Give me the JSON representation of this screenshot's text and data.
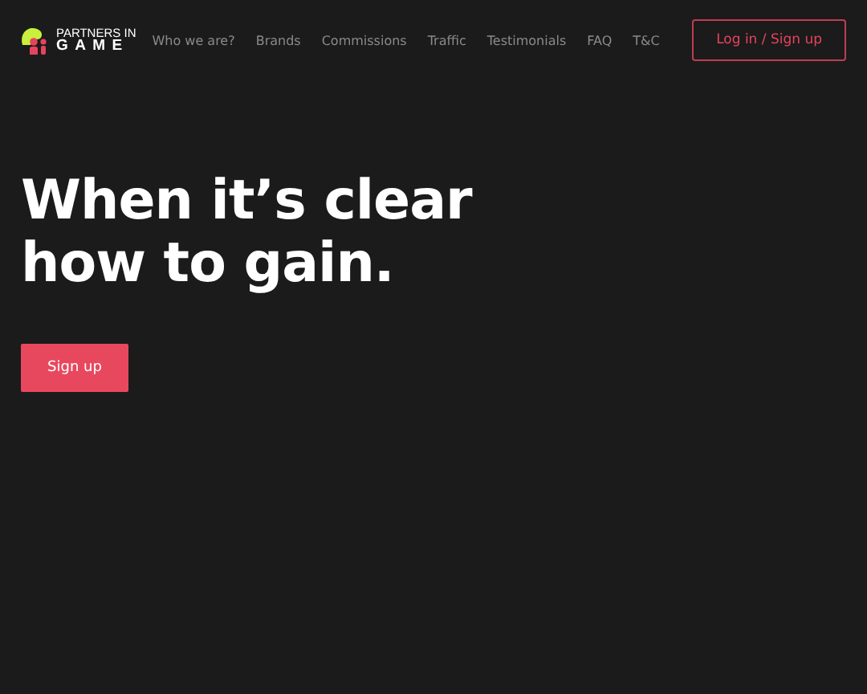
{
  "logo": {
    "line_1": "PARTNERS IN",
    "line_2": "GAME"
  },
  "nav": [
    {
      "label": "Who we are?"
    },
    {
      "label": "Brands"
    },
    {
      "label": "Commissions"
    },
    {
      "label": "Traffic"
    },
    {
      "label": "Testimonials"
    },
    {
      "label": "FAQ"
    },
    {
      "label": "T&C"
    }
  ],
  "login_button": "Log in / Sign up",
  "hero": {
    "lines": [
      "When it’s clear",
      "how to gain."
    ],
    "button": "Sign up"
  }
}
